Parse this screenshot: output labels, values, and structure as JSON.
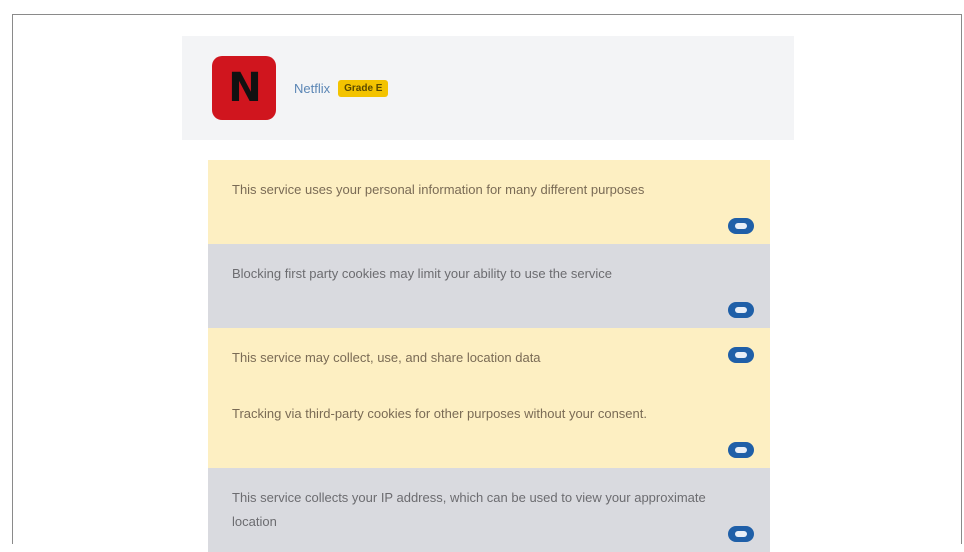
{
  "service": {
    "name": "Netflix",
    "grade": "Grade E",
    "logo_letter": "N",
    "logo_color": "#d0151e"
  },
  "points": [
    {
      "text": "This service uses your personal information for many different purposes",
      "type": "warn",
      "icon": "expand-icon"
    },
    {
      "text": "Blocking first party cookies may limit your ability to use the service",
      "type": "neutral",
      "icon": "expand-icon"
    },
    {
      "text": "This service may collect, use, and share location data",
      "type": "warn",
      "icon": "expand-icon"
    },
    {
      "text": "Tracking via third-party cookies for other purposes without your consent.",
      "type": "warn",
      "icon": "expand-icon"
    },
    {
      "text": "This service collects your IP address, which can be used to view your approximate location",
      "type": "neutral",
      "icon": "expand-icon"
    }
  ],
  "colors": {
    "warn_bg": "#fdefc2",
    "neutral_bg": "#d9dadf",
    "grade_badge": "#f3c300",
    "icon": "#1f5fa8"
  }
}
